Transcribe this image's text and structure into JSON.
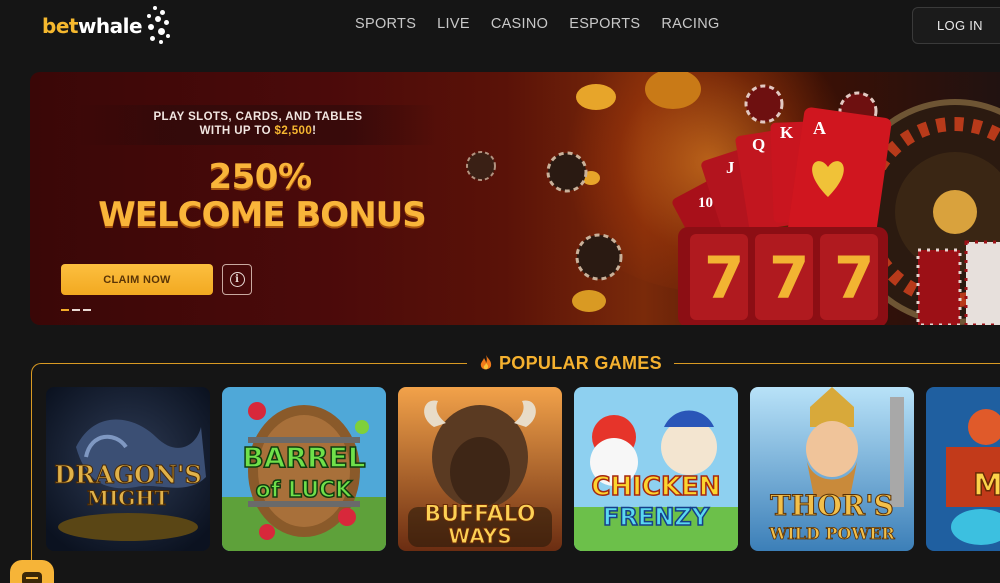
{
  "brand": {
    "name_part1": "bet",
    "name_part2": "whale"
  },
  "nav": {
    "items": [
      "SPORTS",
      "LIVE",
      "CASINO",
      "ESPORTS",
      "RACING"
    ]
  },
  "header": {
    "login_label": "LOG IN"
  },
  "banner": {
    "promo_line1": "PLAY SLOTS, CARDS, AND TABLES",
    "promo_line2_prefix": "WITH UP TO ",
    "promo_amount": "$2,500",
    "promo_line2_suffix": "!",
    "bonus_percent": "250%",
    "bonus_title": "WELCOME BONUS",
    "cta_label": "CLAIM NOW",
    "info_glyph": "i",
    "slide_count": 3,
    "active_slide": 0,
    "slot_reels": [
      "7",
      "7",
      "7"
    ],
    "cards": [
      "10",
      "J",
      "Q",
      "K",
      "A"
    ]
  },
  "popular": {
    "heading": "POPULAR GAMES",
    "games": [
      {
        "title_line1": "DRAGON'S",
        "title_line2": "MIGHT"
      },
      {
        "title_line1": "BARREL",
        "title_line2": "of LUCK"
      },
      {
        "title_line1": "BUFFALO",
        "title_line2": "WAYS"
      },
      {
        "title_line1": "CHICKEN",
        "title_line2": "FRENZY"
      },
      {
        "title_line1": "THOR'S",
        "title_line2": "WILD POWER"
      },
      {
        "title_line1": "M",
        "title_line2": ""
      }
    ]
  },
  "colors": {
    "accent": "#f5b12f",
    "background": "#151515",
    "banner_red": "#4b0a0a"
  },
  "icons": {
    "fire": "fire-icon",
    "info": "info-icon",
    "chat": "chat-icon"
  }
}
